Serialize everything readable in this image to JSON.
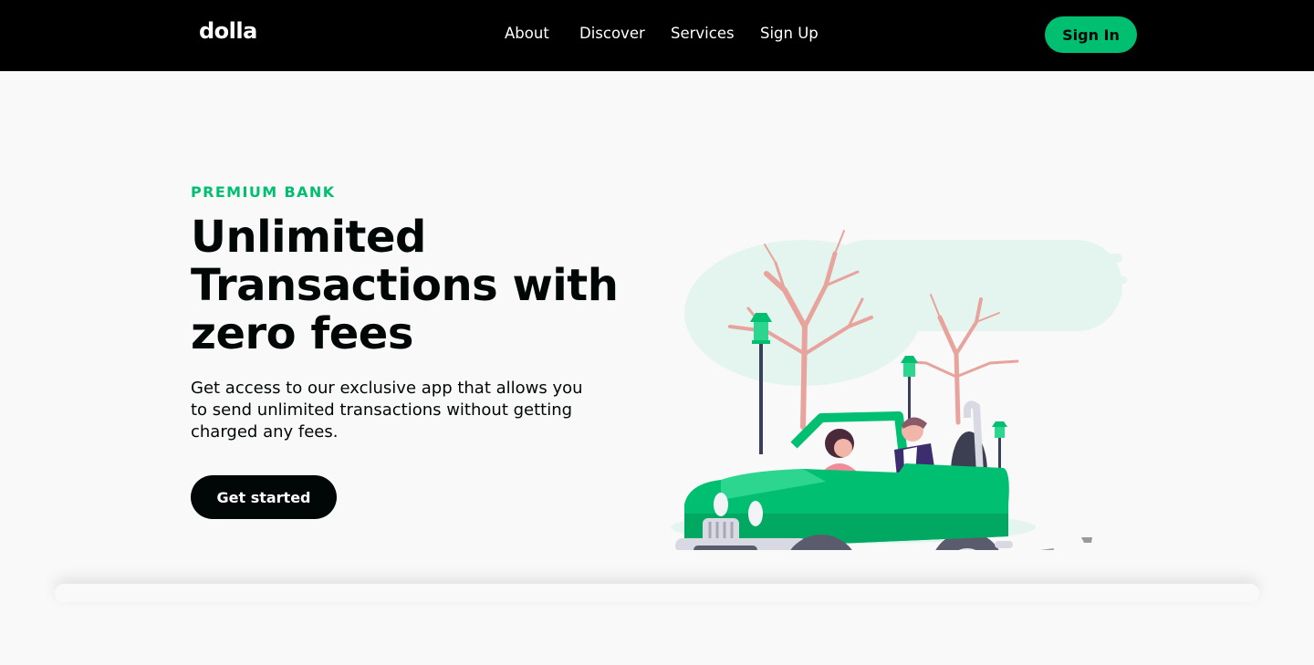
{
  "brand": {
    "logo_text": "dolla",
    "accent_color": "#01bf71",
    "dark_color": "#010606"
  },
  "nav": {
    "links": [
      "About",
      "Discover",
      "Services",
      "Sign Up"
    ],
    "signin_label": "Sign In"
  },
  "hero": {
    "top_line": "PREMIUM BANK",
    "heading": "Unlimited Transactions with zero fees",
    "subtitle": "Get access to our exclusive app that allows you to send unlimited transactions without getting charged any fees.",
    "cta_label": "Get started"
  }
}
